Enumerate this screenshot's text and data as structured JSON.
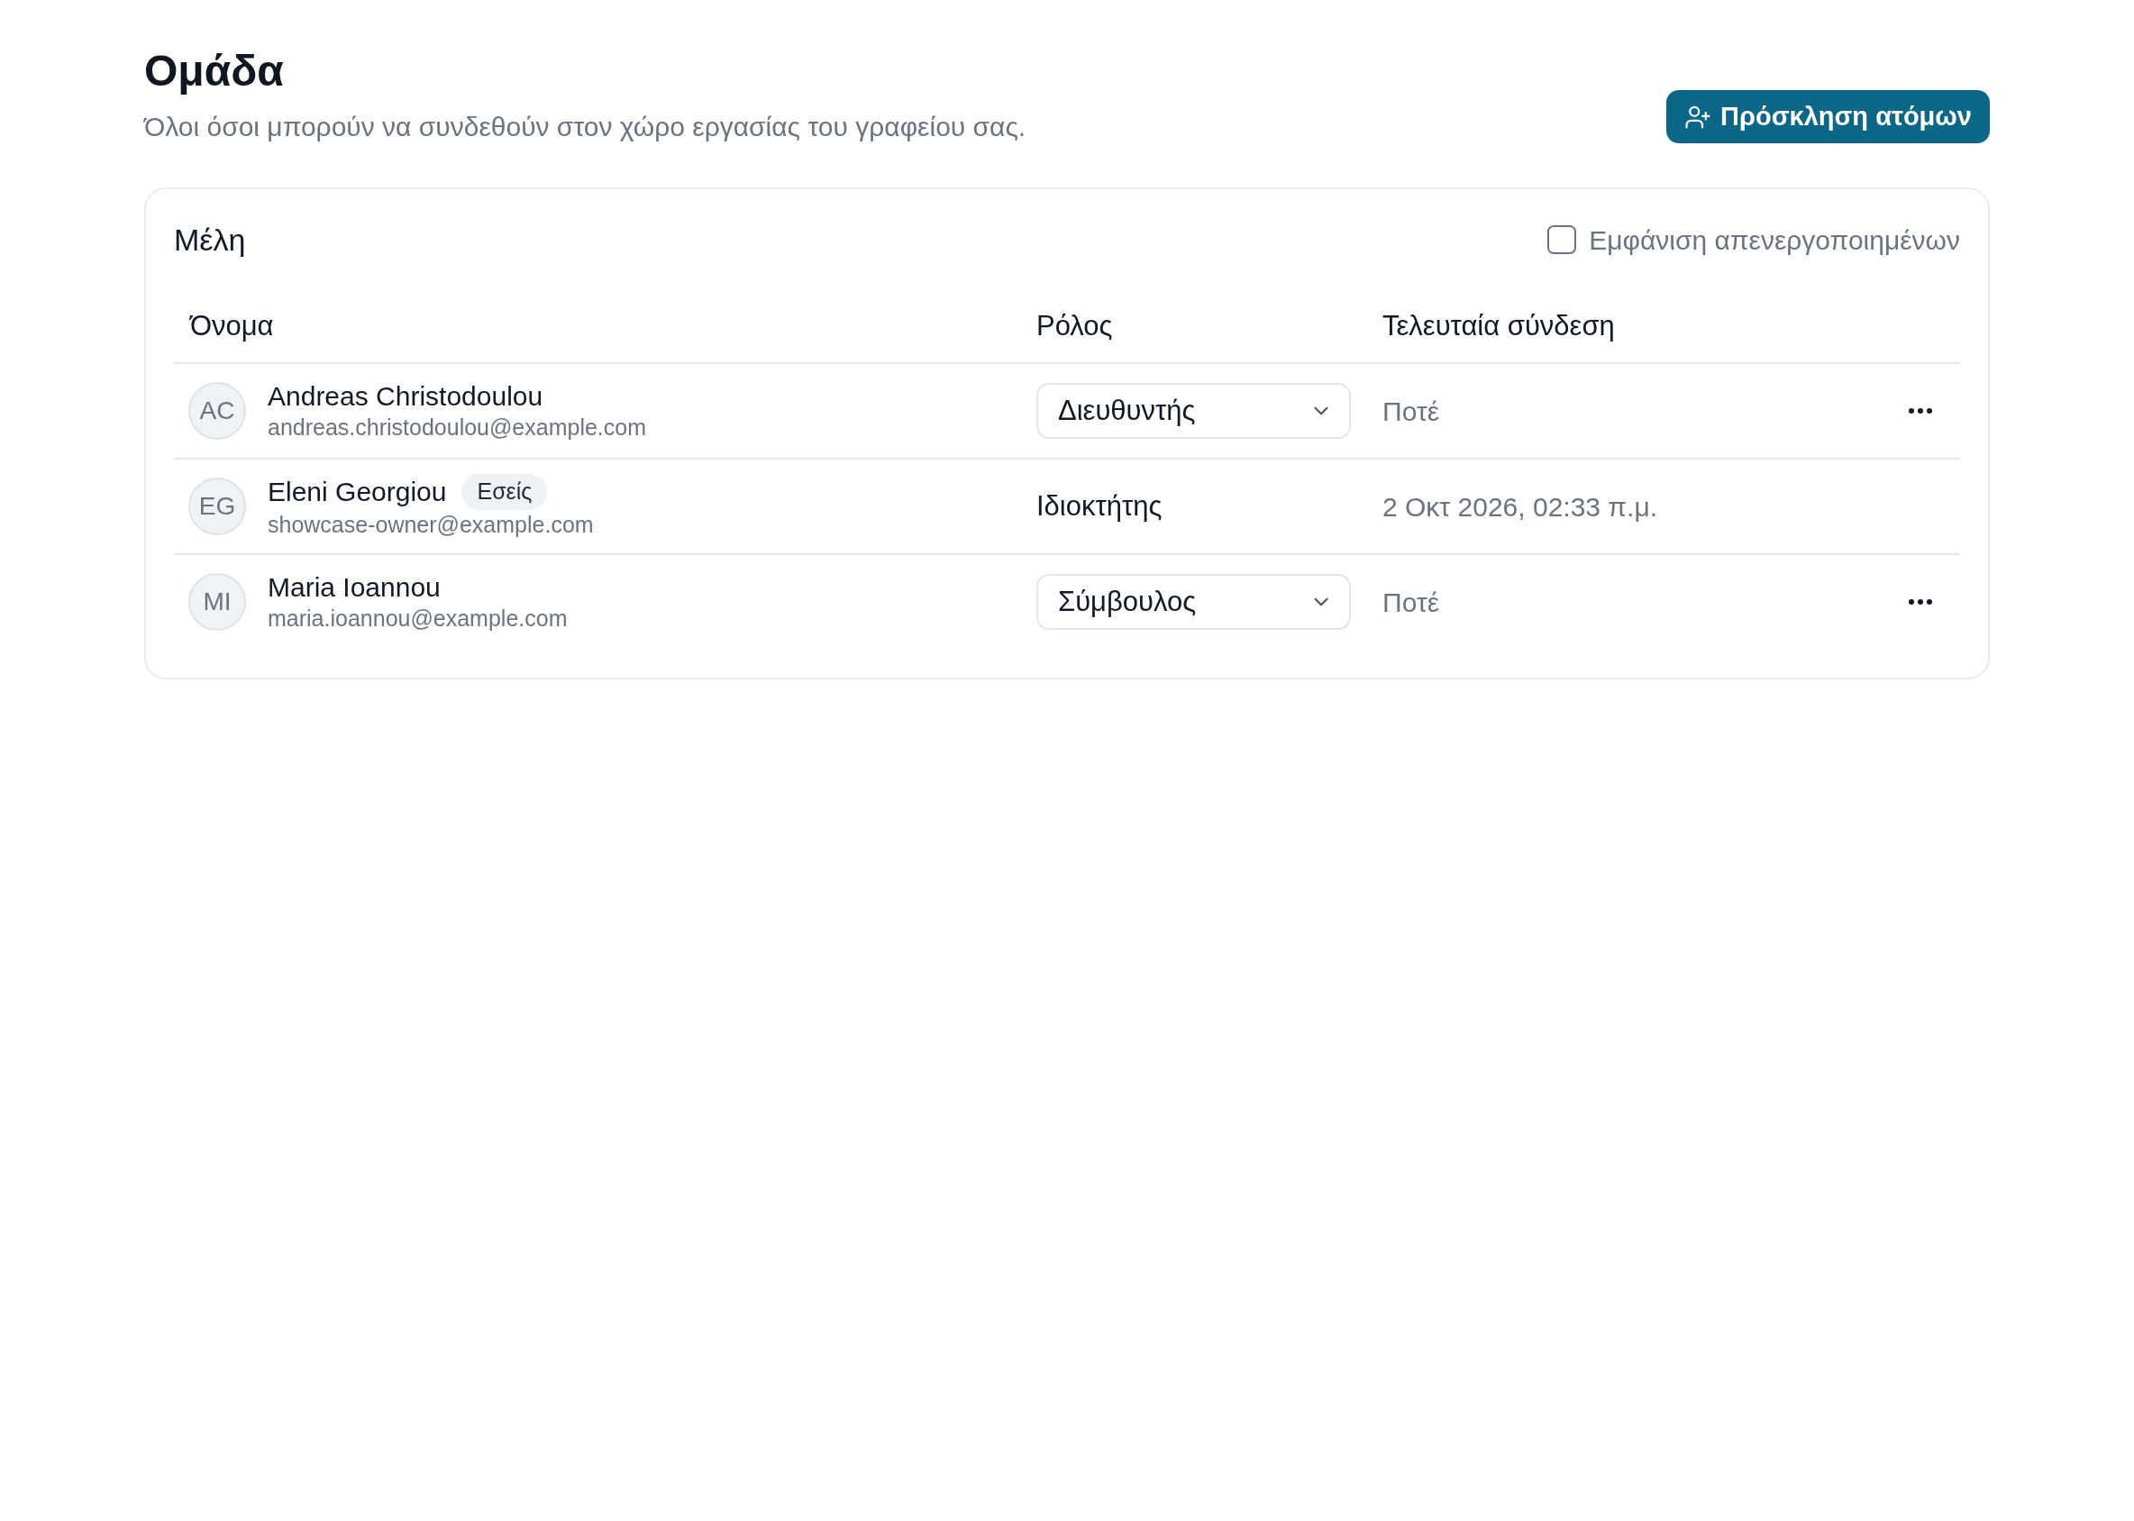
{
  "header": {
    "title": "Ομάδα",
    "subtitle": "Όλοι όσοι μπορούν να συνδεθούν στον χώρο εργασίας του γραφείου σας.",
    "invite_button": {
      "label": "Πρόσκληση ατόμων"
    }
  },
  "members": {
    "title": "Μέλη",
    "show_deactivated": {
      "label": "Εμφάνιση απενεργοποιημένων",
      "checked": false
    },
    "table": {
      "columns": [
        "Όνομα",
        "Ρόλος",
        "Τελευταία σύνδεση"
      ],
      "rows": [
        {
          "initials": "AC",
          "name": "Andreas Christodoulou",
          "email": "andreas.christodoulou@example.com",
          "role": {
            "kind": "select",
            "value": "Διευθυντής"
          },
          "last_login": "Ποτέ",
          "menu": true
        },
        {
          "initials": "EG",
          "name": "Eleni Georgiou",
          "tag": "Εσείς",
          "email": "showcase-owner@example.com",
          "role": {
            "kind": "text",
            "value": "Ιδιοκτήτης"
          },
          "last_login": "2 Οκτ 2026, 02:33 π.μ.",
          "menu": false
        },
        {
          "initials": "MI",
          "name": "Maria Ioannou",
          "email": "maria.ioannou@example.com",
          "role": {
            "kind": "select",
            "value": "Σύμβουλος"
          },
          "last_login": "Ποτέ",
          "menu": true
        }
      ]
    }
  }
}
